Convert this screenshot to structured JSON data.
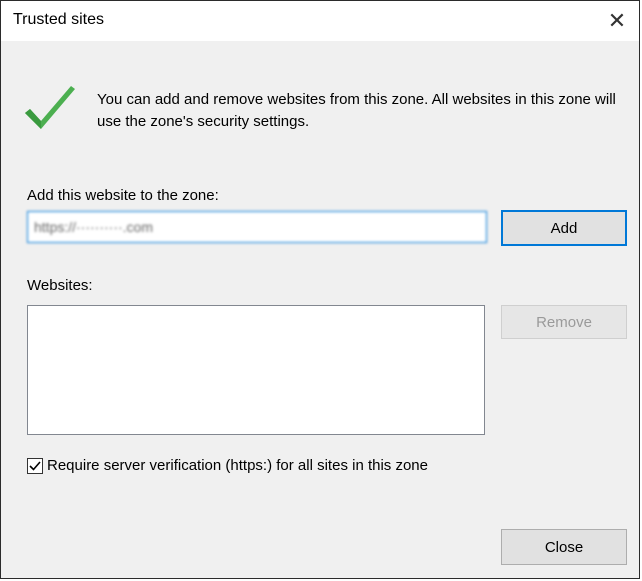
{
  "window": {
    "title": "Trusted sites",
    "close_glyph": "✕",
    "close_icon": "close-icon"
  },
  "info": {
    "icon": "checkmark-icon",
    "icon_color": "#4caf50",
    "text": "You can add and remove websites from this zone. All websites in this zone will use the zone's security settings."
  },
  "add_site": {
    "label": "Add this website to the zone:",
    "value": "https://··········.com",
    "button_label": "Add"
  },
  "websites": {
    "label": "Websites:",
    "items": [],
    "remove_label": "Remove"
  },
  "verification": {
    "checked": true,
    "label": "Require server verification (https:) for all sites in this zone"
  },
  "footer": {
    "close_label": "Close"
  },
  "colors": {
    "accent": "#0078d7",
    "dialog_bg": "#f0f0f0",
    "disabled_text": "#9a9a9a"
  }
}
